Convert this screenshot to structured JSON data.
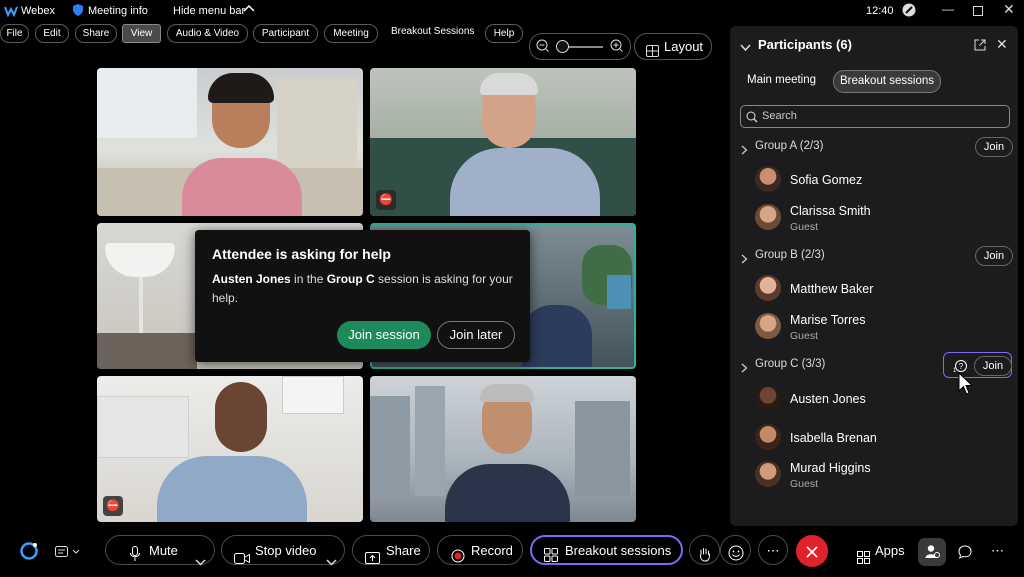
{
  "titlebar": {
    "app_name": "Webex",
    "meeting_info": "Meeting info",
    "hide_menu": "Hide menu bar",
    "time": "12:40"
  },
  "menu": [
    "File",
    "Edit",
    "Share",
    "View",
    "Audio & Video",
    "Participant",
    "Meeting",
    "Breakout Sessions",
    "Help"
  ],
  "layout_label": "Layout",
  "popup": {
    "title": "Attendee is asking for help",
    "body_name": "Austen Jones",
    "body_mid": " in the ",
    "body_group": "Group C",
    "body_end": " session is asking for your help.",
    "join_session": "Join session",
    "join_later": "Join later"
  },
  "panel": {
    "title": "Participants (6)",
    "tabs": [
      "Main meeting",
      "Breakout sessions"
    ],
    "search_placeholder": "Search",
    "join_label": "Join",
    "groups": [
      {
        "label": "Group A (2/3)",
        "members": [
          {
            "name": "Sofia Gomez",
            "sub": ""
          },
          {
            "name": "Clarissa Smith",
            "sub": "Guest"
          }
        ]
      },
      {
        "label": "Group B (2/3)",
        "members": [
          {
            "name": "Matthew Baker",
            "sub": ""
          },
          {
            "name": "Marise Torres",
            "sub": "Guest"
          }
        ]
      },
      {
        "label": "Group C (3/3)",
        "members": [
          {
            "name": "Austen Jones",
            "sub": ""
          },
          {
            "name": "Isabella Brenan",
            "sub": ""
          },
          {
            "name": "Murad Higgins",
            "sub": "Guest"
          }
        ]
      }
    ]
  },
  "toolbar": {
    "mute": "Mute",
    "stop_video": "Stop video",
    "share": "Share",
    "record": "Record",
    "breakout": "Breakout sessions",
    "apps": "Apps"
  },
  "colors": {
    "accent_green": "#1d8a5b",
    "breakout_highlight": "#7b6cf6",
    "end_call_red": "#e0222b",
    "active_tile_border": "#2bb39a"
  }
}
